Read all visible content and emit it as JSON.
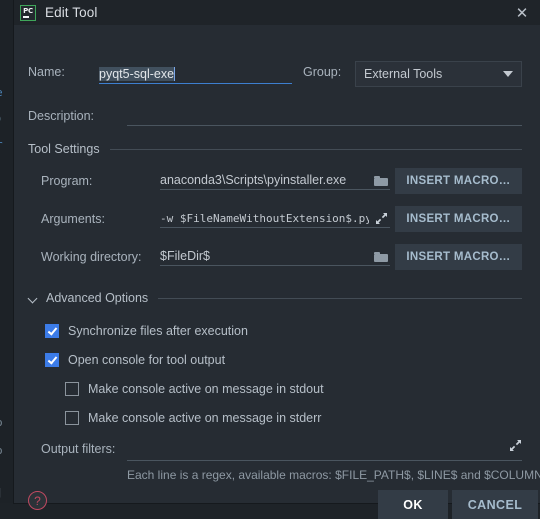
{
  "window": {
    "title": "Edit Tool",
    "app_icon": "pycharm-pc-icon",
    "app_icon_text": "PC",
    "close_icon": "✕"
  },
  "form": {
    "name_label": "Name:",
    "name_value": "pyqt5-sql-exe",
    "group_label": "Group:",
    "group_value": "External Tools",
    "description_label": "Description:",
    "description_value": ""
  },
  "tool_settings": {
    "section_title": "Tool Settings",
    "program_label": "Program:",
    "program_value": "anaconda3\\Scripts\\pyinstaller.exe",
    "arguments_label": "Arguments:",
    "arguments_value": "-w $FileNameWithoutExtension$.py",
    "working_dir_label": "Working directory:",
    "working_dir_value": "$FileDir$",
    "insert_macro_label": "INSERT MACRO…"
  },
  "advanced": {
    "section_title": "Advanced Options",
    "options": [
      {
        "label": "Synchronize files after execution",
        "checked": true
      },
      {
        "label": "Open console for tool output",
        "checked": true
      },
      {
        "label": "Make console active on message in stdout",
        "checked": false
      },
      {
        "label": "Make console active on message in stderr",
        "checked": false
      }
    ],
    "output_filters_label": "Output filters:",
    "output_filters_value": "",
    "output_filters_hint": "Each line is a regex, available macros: $FILE_PATH$, $LINE$ and $COLUMN$"
  },
  "footer": {
    "help_label": "?",
    "ok_label": "OK",
    "cancel_label": "CANCEL"
  },
  "background": {
    "line1": "e",
    "line2": ")",
    "line3": "r",
    "line4": "o",
    "line5": "o",
    "line6": "]"
  },
  "colors": {
    "dialog_bg": "#262c33",
    "titlebar_bg": "#1f2429",
    "accent_blue": "#3c7ce8",
    "focus_underline": "#3d7fd0",
    "button_bg": "#333c46",
    "button_text": "#a6bccd",
    "help_red": "#c14a62",
    "icon_green": "#3fa65a"
  }
}
